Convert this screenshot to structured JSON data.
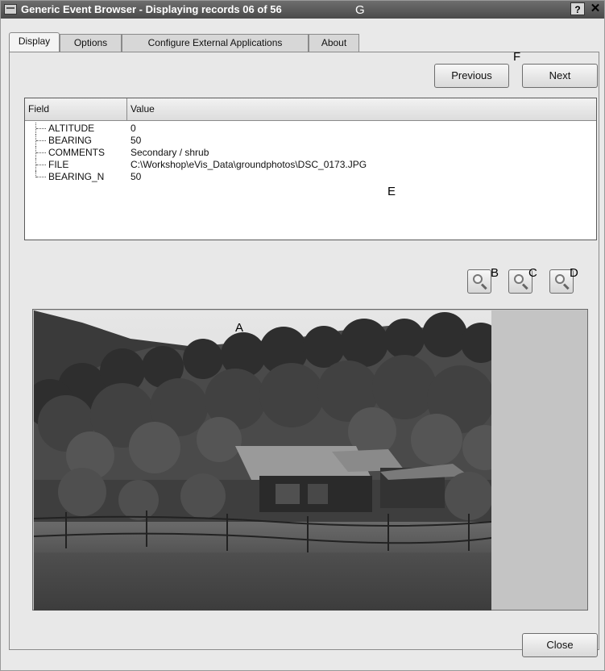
{
  "window": {
    "title": "Generic Event Browser - Displaying records 06 of 56",
    "help_label": "?",
    "close_glyph": "✕"
  },
  "tabs": [
    {
      "label": "Display",
      "active": true
    },
    {
      "label": "Options",
      "active": false
    },
    {
      "label": "Configure External Applications",
      "active": false
    },
    {
      "label": "About",
      "active": false
    }
  ],
  "nav": {
    "previous_label": "Previous",
    "next_label": "Next"
  },
  "table": {
    "headers": {
      "field": "Field",
      "value": "Value"
    },
    "rows": [
      {
        "field": "ALTITUDE",
        "value": "0"
      },
      {
        "field": "BEARING",
        "value": "50"
      },
      {
        "field": "COMMENTS",
        "value": "Secondary / shrub"
      },
      {
        "field": "FILE",
        "value": "C:\\Workshop\\eVis_Data\\groundphotos\\DSC_0173.JPG"
      },
      {
        "field": "BEARING_N",
        "value": "50"
      }
    ]
  },
  "zoom_buttons": [
    {
      "name": "zoom-in-icon"
    },
    {
      "name": "zoom-out-icon"
    },
    {
      "name": "zoom-full-icon"
    }
  ],
  "callouts": {
    "a": "A",
    "b": "B",
    "c": "C",
    "d": "D",
    "e": "E",
    "f": "F",
    "g": "G"
  },
  "footer": {
    "close_label": "Close"
  },
  "colors": {
    "titlebar": "#5a5a5a",
    "dialog_bg": "#e8e8e8",
    "viewer_bg": "#c4c4c4"
  }
}
